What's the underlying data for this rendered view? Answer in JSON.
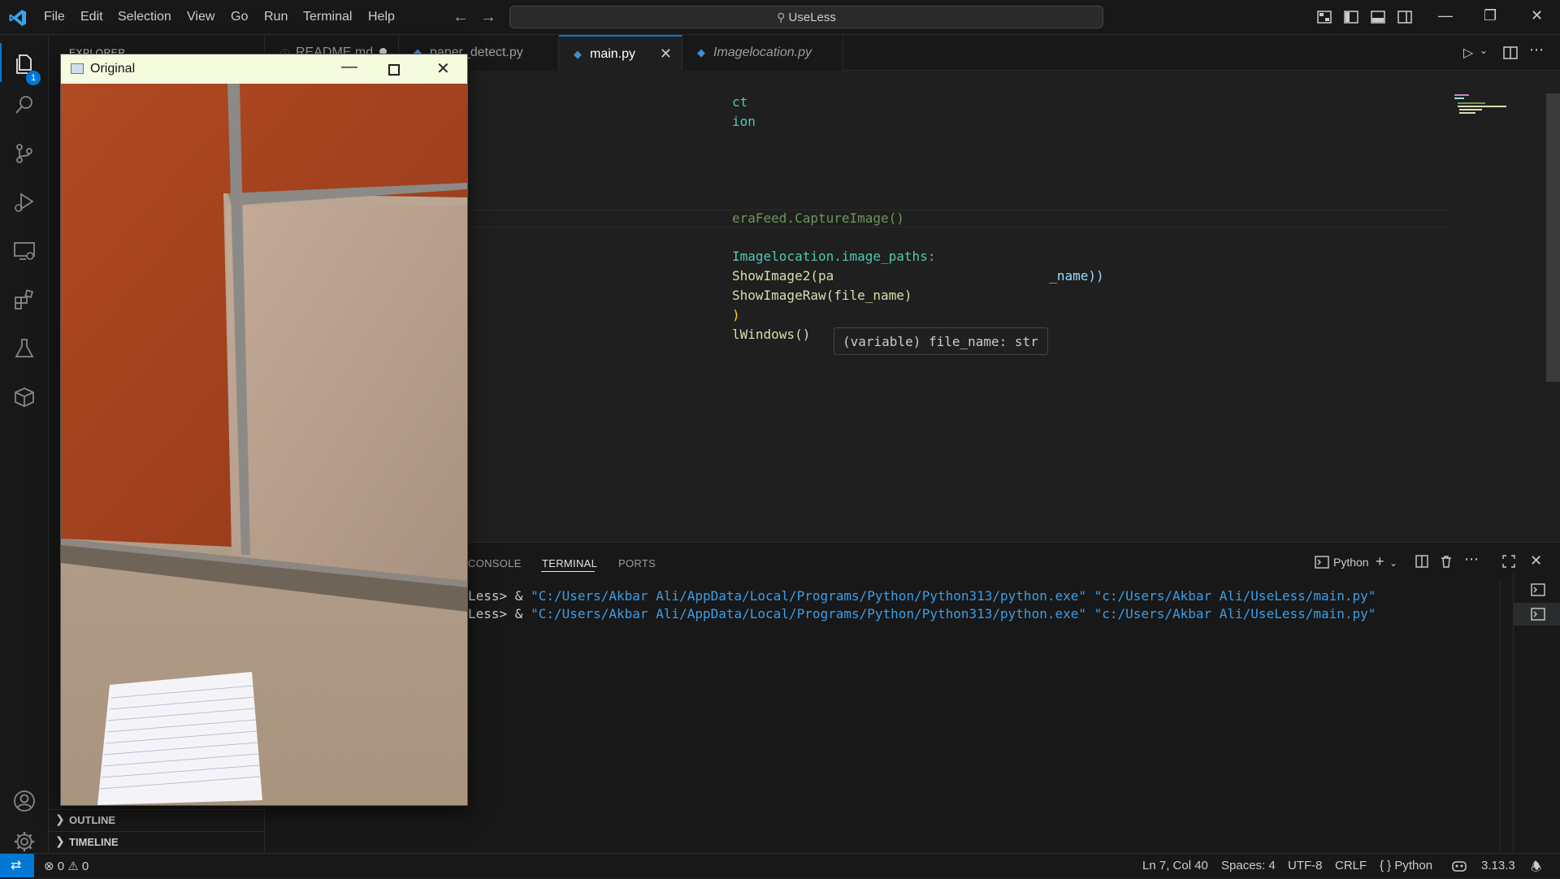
{
  "titlebar": {
    "menu": [
      "File",
      "Edit",
      "Selection",
      "View",
      "Go",
      "Run",
      "Terminal",
      "Help"
    ],
    "search_text": "UseLess"
  },
  "activitybar": {
    "explorer_badge": "1"
  },
  "sidebar": {
    "header": "EXPLORER",
    "sections": [
      "OUTLINE",
      "TIMELINE"
    ]
  },
  "tabs": [
    {
      "name": "README.md",
      "dirty": true
    },
    {
      "name": "paper_detect.py"
    },
    {
      "name": "main.py",
      "active": true
    },
    {
      "name": "Imagelocation.py",
      "italic": true
    }
  ],
  "editor": {
    "lines": [
      {
        "text": "ct",
        "color": "#4ec9b0"
      },
      {
        "text": "ion",
        "color": "#4ec9b0"
      },
      {
        "text": "eraFeed.CaptureImage()",
        "color": "#6a9955"
      },
      {
        "text": "Imagelocation.image_paths:",
        "color": "#4ec9b0"
      },
      {
        "text": "ShowImage2(pa",
        "color": "#dcdcaa",
        "tail": "_name))"
      },
      {
        "text": "ShowImageRaw(file_name)",
        "color": "#dcdcaa"
      },
      {
        "text": ")",
        "color": "#ffd700"
      },
      {
        "text": "lWindows()",
        "color": "#dcdcaa"
      }
    ],
    "hover": "(variable) file_name: str"
  },
  "panel": {
    "tabs": [
      "CONSOLE",
      "TERMINAL",
      "PORTS"
    ],
    "active_tab": "TERMINAL",
    "shell": "Python",
    "terminal_lines": [
      {
        "prefix": "Less> & ",
        "exe": "\"C:/Users/Akbar Ali/AppData/Local/Programs/Python/Python313/python.exe\"",
        "arg": "\"c:/Users/Akbar Ali/UseLess/main.py\""
      },
      {
        "prefix": "Less> & ",
        "exe": "\"C:/Users/Akbar Ali/AppData/Local/Programs/Python/Python313/python.exe\"",
        "arg": "\"c:/Users/Akbar Ali/UseLess/main.py\""
      }
    ]
  },
  "statusbar": {
    "errors": "0",
    "warnings": "0",
    "position": "Ln 7, Col 40",
    "spaces": "Spaces: 4",
    "encoding": "UTF-8",
    "eol": "CRLF",
    "language": "Python",
    "python_version": "3.13.3"
  },
  "image_window": {
    "title": "Original"
  },
  "colors": {
    "accent": "#0078d4",
    "background": "#1f1f1f",
    "chrome": "#181818"
  }
}
